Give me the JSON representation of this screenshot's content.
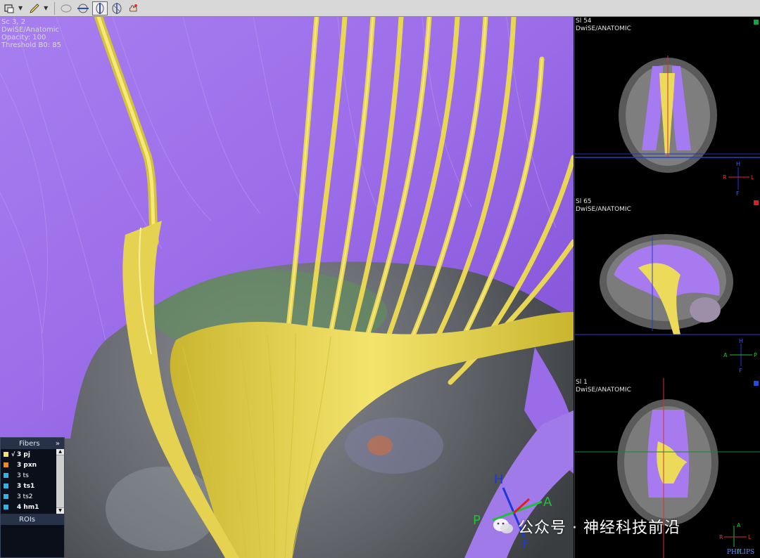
{
  "toolbar": {
    "tools": [
      "select-tool",
      "annotate-tool",
      "ellipse-tool",
      "horizontal-cut-tool",
      "sagittal-cut-tool",
      "coronal-cut-tool",
      "hand-tool"
    ],
    "active_tool": "sagittal-cut-tool"
  },
  "main_view": {
    "info_lines": [
      "Sc 3, 2",
      "DwiSE/Anatomic",
      "Opacity: 100",
      "Threshold B0: 85"
    ],
    "orientation": {
      "h": "H",
      "a": "A",
      "p": "P",
      "f": "F"
    }
  },
  "side_views": [
    {
      "title": "Sl 54",
      "series": "DwiSE/ANATOMIC",
      "marker_color": "#14a83c",
      "orient": [
        "H",
        "R",
        "L",
        "F"
      ]
    },
    {
      "title": "Sl 65",
      "series": "DwiSE/ANATOMIC",
      "marker_color": "#e21b1b",
      "orient": [
        "H",
        "A",
        "P",
        "F"
      ]
    },
    {
      "title": "Sl 1",
      "series": "DwiSE/ANATOMIC",
      "marker_color": "#1a4fe0",
      "orient": [
        "A",
        "R",
        "L",
        "P"
      ]
    }
  ],
  "vendor": "PHILIPS",
  "fibers_panel": {
    "title": "Fibers",
    "expand_label": "»",
    "items": [
      {
        "label": "3 pj",
        "color": "#f4e36a",
        "checked": "√"
      },
      {
        "label": "3 pxn",
        "color": "#f08a1c",
        "checked": ""
      },
      {
        "label": "3 ts",
        "color": "#2fb3e6",
        "checked": ""
      },
      {
        "label": "3 ts1",
        "color": "#2fb3e6",
        "checked": ""
      },
      {
        "label": "3 ts2",
        "color": "#2fb3e6",
        "checked": ""
      },
      {
        "label": "4 hm1",
        "color": "#2fb3e6",
        "checked": ""
      }
    ],
    "rois_title": "ROIs"
  },
  "watermark": "公众号 · 神经科技前沿"
}
